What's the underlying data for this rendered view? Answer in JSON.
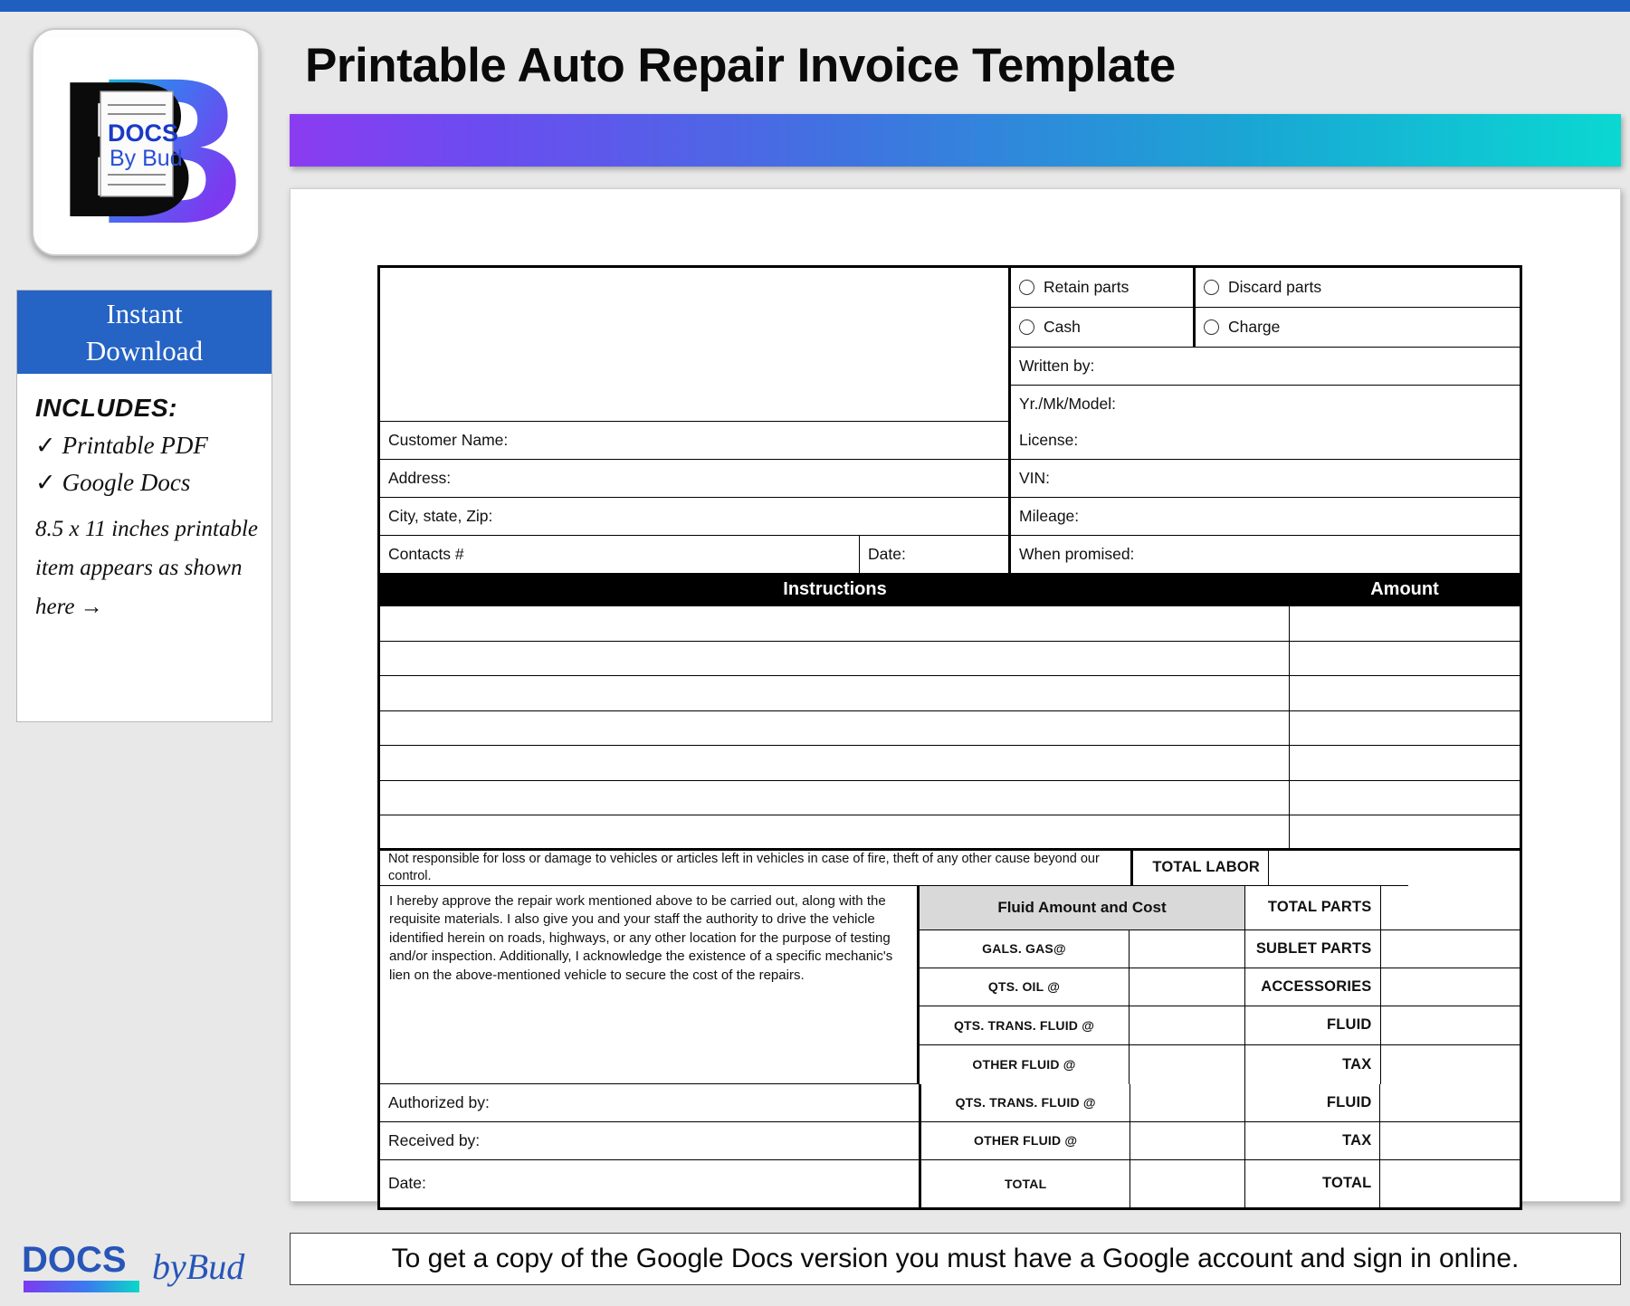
{
  "header": {
    "title": "Printable Auto Repair Invoice Template"
  },
  "sidebar": {
    "logo_alt": "DOCS By Bud",
    "logo_line1": "DOCS",
    "logo_line2": "By Bud",
    "instant_download": "Instant\nDownload",
    "instant_download_line1": "Instant",
    "instant_download_line2": "Download",
    "includes_label": "INCLUDES:",
    "includes": [
      {
        "tick": "✓",
        "label": "Printable PDF"
      },
      {
        "tick": "✓",
        "label": "Google Docs"
      }
    ],
    "size_note": "8.5 x 11 inches printable item appears as shown here →"
  },
  "footer_logo": {
    "docs": "DOCS",
    "by": "by",
    "bud": "Bud"
  },
  "bottom_note": {
    "text": "To get a copy of the Google Docs version you must have a Google account and sign in online."
  },
  "invoice": {
    "options": {
      "retain_parts": "Retain parts",
      "discard_parts": "Discard parts",
      "cash": "Cash",
      "charge": "Charge"
    },
    "right_fields": [
      "Written by:",
      "Yr./Mk/Model:",
      "License:",
      "VIN:",
      "Mileage:",
      "When promised:"
    ],
    "left_fields": [
      "Customer Name:",
      "Address:",
      "City, state, Zip:"
    ],
    "contacts_label": "Contacts #",
    "date_label": "Date:",
    "table_headers": {
      "instructions": "Instructions",
      "amount": "Amount"
    },
    "instruction_rows": [
      "",
      "",
      "",
      "",
      "",
      "",
      ""
    ],
    "disclaimer": "Not responsible for loss or damage to vehicles or articles left in vehicles in case of fire, theft of any other cause beyond our control.",
    "approval_text": "I hereby approve the repair work mentioned above to be carried out, along with the requisite materials. I also give you and your staff the authority to drive the vehicle identified herein on roads, highways, or any other location for the purpose of testing and/or inspection. Additionally, I acknowledge the existence of a specific mechanic's lien on the above-mentioned vehicle to secure the cost of the repairs.",
    "fluid_header": "Fluid Amount and Cost",
    "fluid_rows": [
      {
        "label": "GALS. GAS@",
        "value": ""
      },
      {
        "label": "QTS. OIL @",
        "value": ""
      },
      {
        "label": "QTS. TRANS. FLUID @",
        "value": ""
      },
      {
        "label": "OTHER FLUID @",
        "value": ""
      },
      {
        "label": "TOTAL",
        "value": ""
      }
    ],
    "totals": [
      {
        "label": "TOTAL LABOR",
        "value": ""
      },
      {
        "label": "TOTAL PARTS",
        "value": ""
      },
      {
        "label": "SUBLET PARTS",
        "value": ""
      },
      {
        "label": "ACCESSORIES",
        "value": ""
      },
      {
        "label": "FLUID",
        "value": ""
      },
      {
        "label": "TAX",
        "value": ""
      },
      {
        "label": "TOTAL",
        "value": ""
      }
    ],
    "signature_fields": [
      "Authorized by:",
      "Received by:",
      "Date:"
    ]
  },
  "colors": {
    "top_strip": "#1f5fc0",
    "accent_blue": "#2563c4",
    "gradient_start": "#8b3cf0",
    "gradient_end": "#0ad8d2",
    "page_background": "#e8e8e8"
  }
}
